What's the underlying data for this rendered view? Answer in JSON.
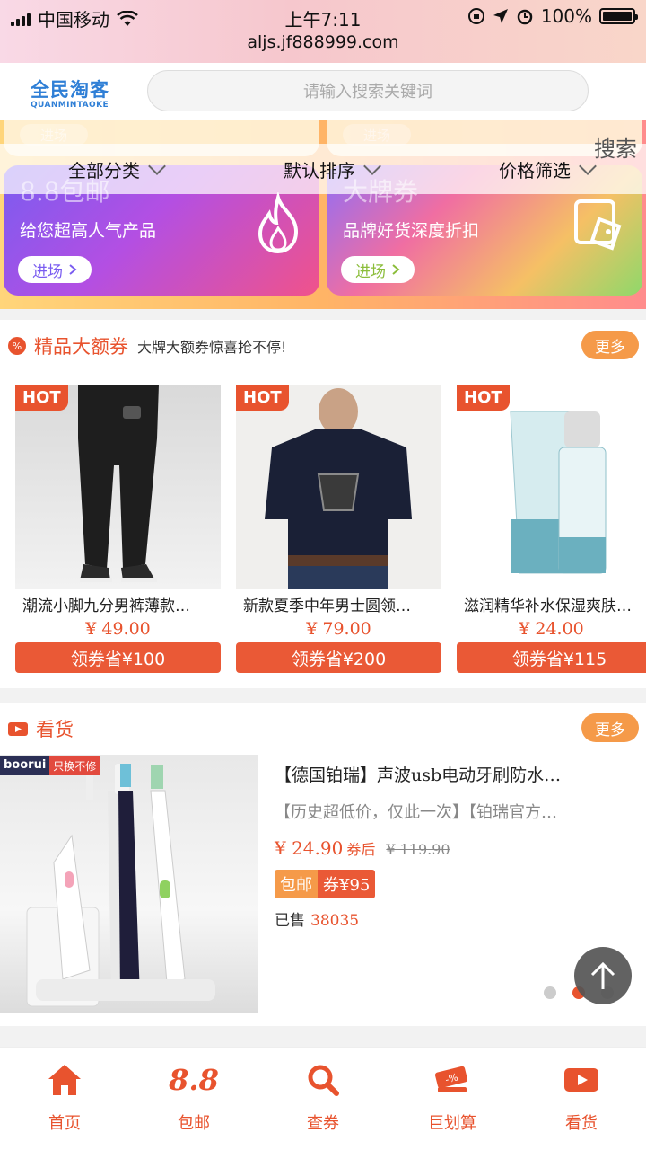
{
  "status_bar": {
    "carrier": "中国移动",
    "time": "上午7:11",
    "url": "aljs.jf888999.com",
    "battery": "100%"
  },
  "header": {
    "logo_cn": "全民淘客",
    "logo_en": "QUANMINTAOKE",
    "search_placeholder": "请输入搜索关键词"
  },
  "banner": {
    "ghost_button": "进场",
    "cards": [
      {
        "title": "8.8包邮",
        "subtitle": "给您超高人气产品",
        "button": "进场",
        "icon": "flame-icon"
      },
      {
        "title": "大牌券",
        "subtitle": "品牌好货深度折扣",
        "button": "进场",
        "icon": "price-tag-icon"
      }
    ]
  },
  "filters": {
    "items": [
      "全部分类",
      "默认排序",
      "价格筛选"
    ],
    "search_label": "搜索"
  },
  "coupon_section": {
    "title": "精品大额券",
    "subtitle": "大牌大额券惊喜抢不停!",
    "more": "更多",
    "badge": "HOT",
    "products": [
      {
        "name": "潮流小脚九分男裤薄款…",
        "price": "¥ 49.00",
        "coupon": "领券省¥100"
      },
      {
        "name": "新款夏季中年男士圆领…",
        "price": "¥ 79.00",
        "coupon": "领券省¥200"
      },
      {
        "name": "滋润精华补水保湿爽肤…",
        "price": "¥ 24.00",
        "coupon": "领券省¥115"
      }
    ]
  },
  "video_section": {
    "title": "看货",
    "more": "更多",
    "brand_tag": "boorui",
    "brand_tag_note": "只换不修",
    "item": {
      "title": "【德国铂瑞】声波usb电动牙刷防水…",
      "desc": "【历史超低价，仅此一次】【铂瑞官方…",
      "price_now": "¥ 24.90",
      "after_coupon": "券后",
      "price_old": "¥ 119.90",
      "tag_postage": "包邮",
      "tag_coupon": "券¥95",
      "sold_label": "已售",
      "sold_count": "38035"
    }
  },
  "tabbar": {
    "items": [
      {
        "label": "首页",
        "icon": "home-icon"
      },
      {
        "label": "包邮",
        "icon": "8.8"
      },
      {
        "label": "查券",
        "icon": "search-icon"
      },
      {
        "label": "巨划算",
        "icon": "discount-icon"
      },
      {
        "label": "看货",
        "icon": "video-icon"
      }
    ]
  },
  "colors": {
    "accent": "#e8532e",
    "orange": "#f59a49",
    "logo_blue": "#2f7fd6"
  }
}
